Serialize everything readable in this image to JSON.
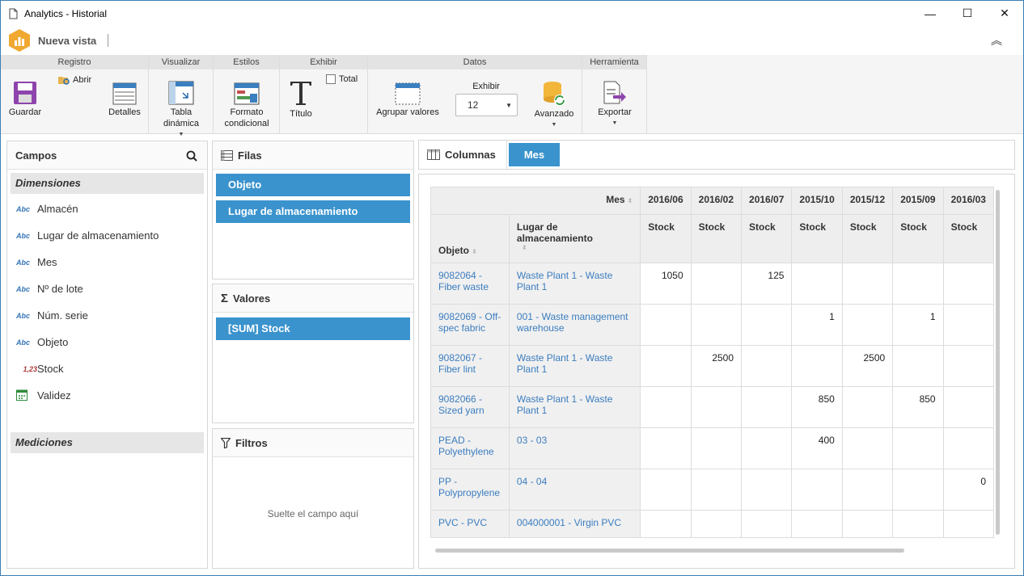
{
  "window": {
    "title": "Analytics - Historial",
    "minimize": "—",
    "maximize": "☐",
    "close": "✕"
  },
  "app": {
    "name": "Nueva vista",
    "collapse": "︽"
  },
  "ribbon": {
    "groups": [
      "Registro",
      "Visualizar",
      "Estilos",
      "Exhibir",
      "Datos",
      "Herramienta"
    ],
    "guardar": "Guardar",
    "abrir": "Abrir",
    "detalles": "Detalles",
    "tabla_dinamica": "Tabla dinámica",
    "formato_condicional": "Formato condicional",
    "titulo": "Título",
    "total": "Total",
    "agrupar_valores": "Agrupar valores",
    "exhibir_label": "Exhibir",
    "exhibir_value": "12",
    "avanzado": "Avanzado",
    "exportar": "Exportar"
  },
  "campos": {
    "title": "Campos",
    "dimensiones": "Dimensiones",
    "items": [
      {
        "icon": "Abc",
        "label": "Almacén"
      },
      {
        "icon": "Abc",
        "label": "Lugar de almacenamiento"
      },
      {
        "icon": "Abc",
        "label": "Mes"
      },
      {
        "icon": "Abc",
        "label": "Nº de lote"
      },
      {
        "icon": "Abc",
        "label": "Núm. serie"
      },
      {
        "icon": "Abc",
        "label": "Objeto"
      },
      {
        "icon": "1,23",
        "label": "Stock"
      },
      {
        "icon": "calendar-icon",
        "label": "Validez"
      }
    ],
    "mediciones": "Mediciones"
  },
  "filas": {
    "title": "Filas",
    "chips": [
      "Objeto",
      "Lugar de almacenamiento"
    ]
  },
  "valores": {
    "title": "Valores",
    "chips": [
      "[SUM] Stock"
    ]
  },
  "filtros": {
    "title": "Filtros",
    "hint": "Suelte el campo aquí"
  },
  "columnas": {
    "title": "Columnas",
    "chip": "Mes"
  },
  "pivot": {
    "mes_label": "Mes",
    "months": [
      "2016/06",
      "2016/02",
      "2016/07",
      "2015/10",
      "2015/12",
      "2015/09",
      "2016/03"
    ],
    "measure": "Stock",
    "objeto_label": "Objeto",
    "lugar_label": "Lugar de almacenamiento",
    "rows": [
      {
        "objeto": "9082064 - Fiber waste",
        "lugar": "Waste Plant 1 - Waste Plant 1",
        "values": [
          "1050",
          "",
          "125",
          "",
          "",
          "",
          ""
        ]
      },
      {
        "objeto": "9082069 - Off-spec fabric",
        "lugar": "001 - Waste management warehouse",
        "values": [
          "",
          "",
          "",
          "1",
          "",
          "1",
          ""
        ]
      },
      {
        "objeto": "9082067 - Fiber lint",
        "lugar": "Waste Plant 1 - Waste Plant 1",
        "values": [
          "",
          "2500",
          "",
          "",
          "2500",
          "",
          ""
        ]
      },
      {
        "objeto": "9082066 - Sized yarn",
        "lugar": "Waste Plant 1 - Waste Plant 1",
        "values": [
          "",
          "",
          "",
          "850",
          "",
          "850",
          ""
        ]
      },
      {
        "objeto": "PEAD - Polyethylene",
        "lugar": "03 - 03",
        "values": [
          "",
          "",
          "",
          "400",
          "",
          "",
          ""
        ]
      },
      {
        "objeto": "PP - Polypropylene",
        "lugar": "04 - 04",
        "values": [
          "",
          "",
          "",
          "",
          "",
          "",
          "0"
        ]
      },
      {
        "objeto": "PVC - PVC",
        "lugar": "004000001 - Virgin PVC",
        "values": [
          "",
          "",
          "",
          "",
          "",
          "",
          ""
        ]
      }
    ]
  }
}
